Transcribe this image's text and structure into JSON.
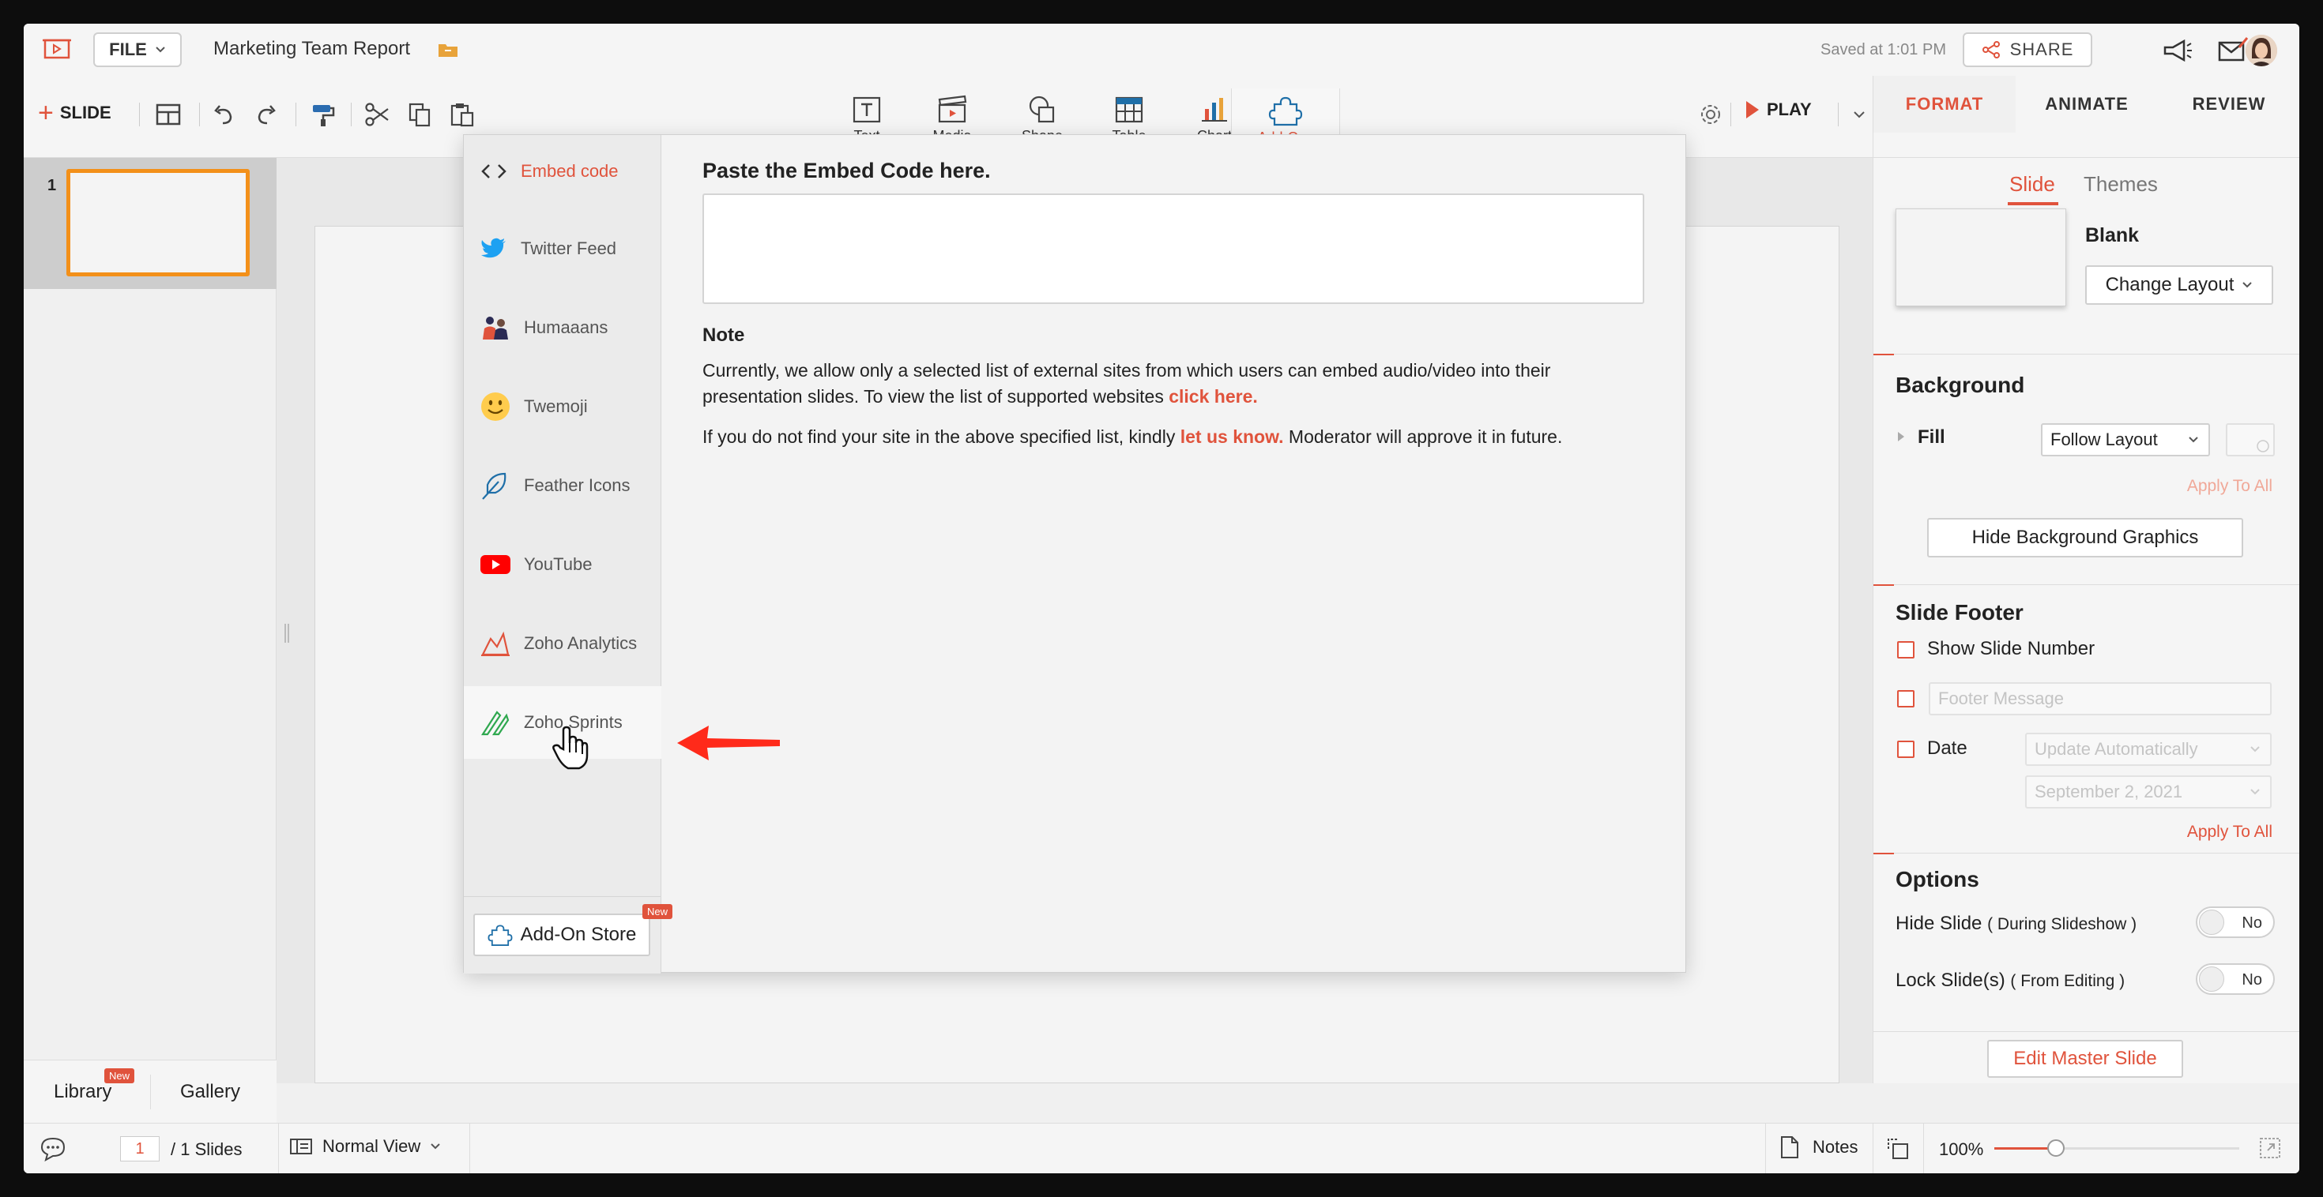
{
  "topbar": {
    "file_label": "FILE",
    "doc_title": "Marketing Team Report",
    "saved_text": "Saved at 1:01 PM",
    "share_label": "SHARE"
  },
  "toolbar": {
    "add_slide_label": "SLIDE",
    "insert_items": [
      {
        "label": "Text",
        "icon": "text-box-icon"
      },
      {
        "label": "Media",
        "icon": "clapperboard-icon"
      },
      {
        "label": "Shape",
        "icon": "shape-icon"
      },
      {
        "label": "Table",
        "icon": "table-icon"
      },
      {
        "label": "Chart",
        "icon": "bar-chart-icon"
      },
      {
        "label": "Add-Ons",
        "icon": "puzzle-icon"
      }
    ],
    "play_label": "PLAY"
  },
  "right_tabs": [
    "FORMAT",
    "ANIMATE",
    "REVIEW"
  ],
  "slides_panel": {
    "slide_number": "1",
    "library_label": "Library",
    "library_badge": "New",
    "gallery_label": "Gallery"
  },
  "addon_dialog": {
    "items": [
      {
        "label": "Embed code",
        "icon": "code-brackets-icon"
      },
      {
        "label": "Twitter Feed",
        "icon": "twitter-bird-icon"
      },
      {
        "label": "Humaaans",
        "icon": "humaaans-icon"
      },
      {
        "label": "Twemoji",
        "icon": "smiley-emoji-icon"
      },
      {
        "label": "Feather Icons",
        "icon": "feather-icon"
      },
      {
        "label": "YouTube",
        "icon": "youtube-play-icon"
      },
      {
        "label": "Zoho Analytics",
        "icon": "analytics-chart-icon"
      },
      {
        "label": "Zoho Sprints",
        "icon": "sprints-icon"
      }
    ],
    "store_label": "Add-On Store",
    "store_badge": "New",
    "title": "Paste the Embed Code here.",
    "input_value": "",
    "note_heading": "Note",
    "note_p1_text": "Currently, we allow only a selected list of external sites from which users can embed audio/video into their presentation slides. To view the list of supported websites ",
    "note_p1_link": "click here.",
    "note_p2_text": "If you do not find your site in the above specified list, kindly ",
    "note_p2_link": "let us know.",
    "note_p2_tail": " Moderator will approve it in future."
  },
  "format_panel": {
    "subtab_slide": "Slide",
    "subtab_themes": "Themes",
    "layout_name": "Blank",
    "change_layout_label": "Change Layout",
    "background_heading": "Background",
    "fill_label": "Fill",
    "fill_value": "Follow Layout",
    "apply_all_disabled": "Apply To All",
    "hide_bg_label": "Hide Background Graphics",
    "footer_heading": "Slide Footer",
    "show_slide_number_label": "Show Slide Number",
    "footer_message_placeholder": "Footer Message",
    "date_label": "Date",
    "date_mode_value": "Update Automatically",
    "date_value": "September 2, 2021",
    "apply_all_label": "Apply To All",
    "options_heading": "Options",
    "hide_slide_label": "Hide Slide",
    "hide_slide_hint": "( During Slideshow )",
    "hide_slide_value": "No",
    "lock_slide_label": "Lock Slide(s)",
    "lock_slide_hint": "( From Editing )",
    "lock_slide_value": "No",
    "edit_master_label": "Edit Master Slide"
  },
  "statusbar": {
    "current_page": "1",
    "total_slides": "/ 1 Slides",
    "view_label": "Normal View",
    "notes_label": "Notes",
    "zoom_label": "100%",
    "zoom_fraction": 0.25
  },
  "colors": {
    "accent": "#e0533c",
    "thumb_border": "#f39019"
  }
}
